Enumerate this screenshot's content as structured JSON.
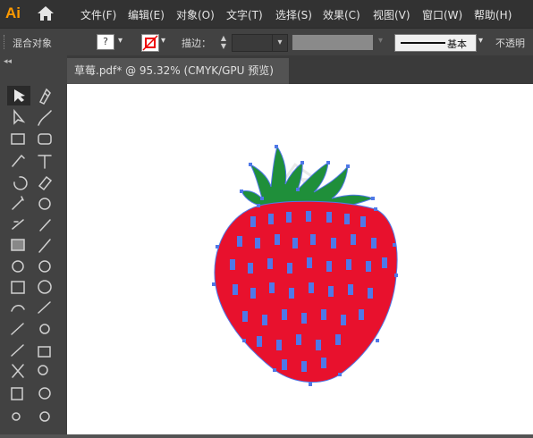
{
  "app": {
    "logo": "Ai"
  },
  "menu": [
    "文件(F)",
    "编辑(E)",
    "对象(O)",
    "文字(T)",
    "选择(S)",
    "效果(C)",
    "视图(V)",
    "窗口(W)",
    "帮助(H)"
  ],
  "control": {
    "label": "混合对象",
    "fill_value": "?",
    "stroke_label": "描边：",
    "brush_label": "基本",
    "opacity_label": "不透明"
  },
  "document": {
    "tab_title": "草莓.pdf* @ 95.32% (CMYK/GPU 预览)"
  },
  "colors": {
    "strawberry": "#e8112d",
    "leaves": "#1f8f3a",
    "anchor": "#4f78e8",
    "selection": "#4f78e8"
  },
  "tools": [
    "selection-tool",
    "direct-selection-tool",
    "rectangle-tool",
    "paintbrush-tool",
    "rotate-tool",
    "magic-wand-tool",
    "anchor-point-tool",
    "gradient-tool",
    "twirl-tool",
    "mesh-tool",
    "shape-builder-tool",
    "brush-tool",
    "symbol-sprayer-tool",
    "knife-tool",
    "artboard-tool",
    "perspective-tool"
  ]
}
